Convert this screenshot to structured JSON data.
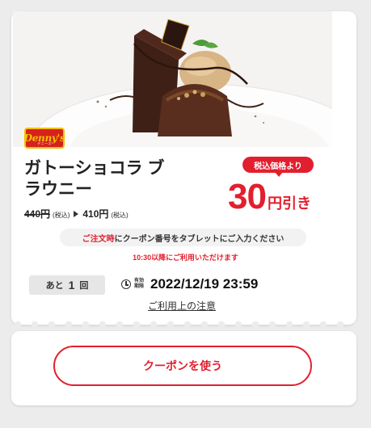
{
  "brand": {
    "logo_text": "Denny's",
    "logo_sub": "デニーズ"
  },
  "coupon": {
    "title": "ガトーショコラ ブラウニー",
    "original_price": "440円",
    "original_tax": "(税込)",
    "new_price": "410円",
    "new_tax": "(税込)",
    "badge": "税込価格より",
    "discount_number": "30",
    "discount_unit": "円引き",
    "notice_red": "ご注文時",
    "notice_rest": "にクーポン番号をタブレットにご入力ください",
    "time_note": "10:30以降にご利用いただけます",
    "remaining_label": "あと",
    "remaining_count": "1",
    "remaining_unit": "回",
    "deadline_label": "有効期限",
    "deadline": "2022/12/19 23:59",
    "terms_link": "ご利用上の注意"
  },
  "actions": {
    "use_button": "クーポンを使う"
  },
  "colors": {
    "accent": "#e21f2e",
    "logo_bg": "#d7211a",
    "logo_text": "#f3c200"
  }
}
